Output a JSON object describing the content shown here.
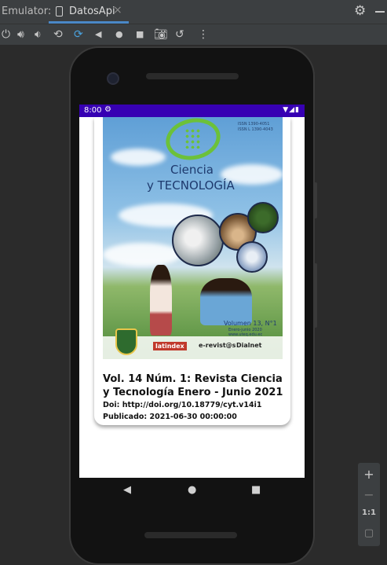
{
  "ide": {
    "panel_label": "Emulator:",
    "tab_name": "DatosApi",
    "tab_close": "×",
    "gear": "⚙"
  },
  "toolbar_icons": [
    "power-icon",
    "volume-up-icon",
    "volume-down-icon",
    "rotate-left-icon",
    "rotate-right-icon",
    "back-icon",
    "home-icon",
    "overview-icon",
    "screenshot-icon",
    "replay-icon",
    "more-icon"
  ],
  "phone": {
    "status": {
      "time": "8:00",
      "icons": "▼◢▮"
    },
    "card": {
      "cover": {
        "issn_lines": [
          "ISSN 1390-4051",
          "ISSN L 1390-4043"
        ],
        "title_line1": "Ciencia",
        "title_line2": "y TECNOLOGÍA",
        "volume": "Volumen 13, N°1",
        "volume_sub": [
          "Enero-junio 2020",
          "www.uteq.edu.ec"
        ],
        "index_logos": [
          "latindex",
          "e-revist@s",
          "Dialnet"
        ]
      },
      "title": "Vol. 14 Núm. 1: Revista Ciencia y Tecnología Enero - Junio 2021",
      "doi": "Doi: http://doi.org/10.18779/cyt.v14i1",
      "published": "Publicado: 2021-06-30 00:00:00"
    },
    "nav": {
      "back": "◀",
      "home": "●",
      "recent": "■"
    }
  },
  "side_panel": {
    "zoom_in": "+",
    "zoom_out": "−",
    "ratio": "1:1",
    "fit": "▢"
  }
}
